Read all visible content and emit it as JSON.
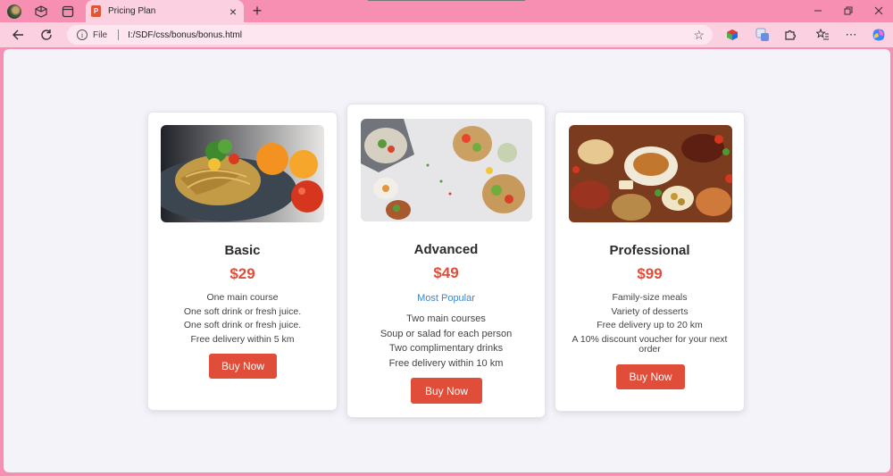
{
  "browser": {
    "tab_title": "Pricing Plan",
    "tab_favicon_letter": "P",
    "address_scheme": "File",
    "address_url": "I:/SDF/css/bonus/bonus.html"
  },
  "plans": [
    {
      "name": "Basic",
      "price": "$29",
      "features": [
        "One main course",
        "One soft drink or fresh juice.",
        "One soft drink or fresh juice.",
        "Free delivery within 5 km"
      ],
      "button_label": "Buy Now"
    },
    {
      "name": "Advanced",
      "price": "$49",
      "badge": "Most Popular",
      "features": [
        "Two main courses",
        "Soup or salad for each person",
        "Two complimentary drinks",
        "Free delivery within 10 km"
      ],
      "button_label": "Buy Now"
    },
    {
      "name": "Professional",
      "price": "$99",
      "features": [
        "Family-size meals",
        "Variety of desserts",
        "Free delivery up to 20 km",
        "A 10% discount voucher for your next order"
      ],
      "button_label": "Buy Now"
    }
  ],
  "colors": {
    "accent": "#e04e3a",
    "badge": "#3f86c9",
    "browser_frame": "#f78fb3",
    "page_background": "#f4f3f9"
  }
}
